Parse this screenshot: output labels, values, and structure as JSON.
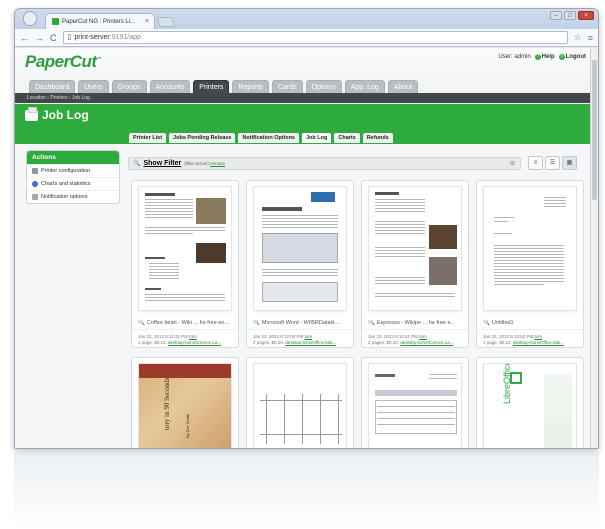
{
  "browser": {
    "tab_title": "PaperCut NG : Printers Li...",
    "tab_close": "×",
    "url_host": "print-server",
    "url_rest": ":9191/app",
    "back": "←",
    "forward": "→",
    "reload": "C",
    "star": "☆",
    "menu": "≡"
  },
  "header": {
    "logo": "PaperCut",
    "logo_tm": "™",
    "user_label": "User: admin",
    "help": "Help",
    "logout": "Logout"
  },
  "nav": [
    "Dashboard",
    "Users",
    "Groups",
    "Accounts",
    "Printers",
    "Reports",
    "Cards",
    "Options",
    "App. Log",
    "About"
  ],
  "nav_active": "Printers",
  "breadcrumb": "Location › Printers › Job Log",
  "page_title": "Job Log",
  "subtabs": [
    "Printer List",
    "Jobs Pending Release",
    "Notification Options",
    "Job Log",
    "Charts",
    "Refunds"
  ],
  "subtab_active": "Job Log",
  "actions": {
    "title": "Actions",
    "items": [
      "Printer configuration",
      "Charts and statistics",
      "Notification options"
    ]
  },
  "filter": {
    "label": "Show Filter",
    "note": "(filter active)",
    "remove": "remove"
  },
  "cards": [
    {
      "title": "Coffee bean - Wiki ... he free en...",
      "date": "Jan 22, 2013 6:11:32 PM",
      "user": "tom",
      "detail": "1 page, $0.10,",
      "doc": "desktop-bomiScience.La..."
    },
    {
      "title": "Microsoft Word - W05RDataH...",
      "date": "Jan 22, 2013 6:12:04 PM",
      "user": "tom",
      "detail": "2 pages, $0.20,",
      "doc": "desktop-bomiOffice.Mai..."
    },
    {
      "title": "Espresso - Wikipe ... he free e...",
      "date": "Jan 22, 2013 6:11:61 PM",
      "user": "tom",
      "detail": "2 pages, $0.20,",
      "doc": "desktop-bomiScience.La..."
    },
    {
      "title": "Untitled1",
      "date": "Jan 22, 2013 6:10:52 PM",
      "user": "tom",
      "detail": "1 page, $0.10,",
      "doc": "desktop-bomiOffice.Mai..."
    }
  ],
  "second_row": {
    "book_title": "tory in 90 Seconds",
    "book_author": "By Zoe Smith",
    "libreoffice": "LibreOffice"
  },
  "colors": {
    "brand_green": "#2eab3d",
    "dark_bar": "#444749",
    "nav_active": "#45494c"
  }
}
